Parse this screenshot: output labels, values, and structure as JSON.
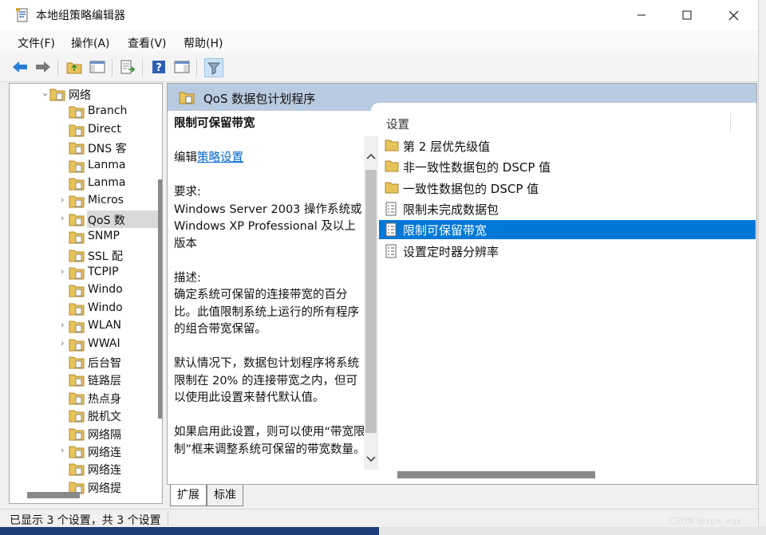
{
  "window": {
    "title": "本地组策略编辑器"
  },
  "menu": [
    "文件(F)",
    "操作(A)",
    "查看(V)",
    "帮助(H)"
  ],
  "tree": {
    "items": [
      {
        "label": "网络",
        "expanded": true
      },
      {
        "label": "Branch"
      },
      {
        "label": "Direct"
      },
      {
        "label": "DNS 客"
      },
      {
        "label": "Lanma"
      },
      {
        "label": "Lanma"
      },
      {
        "label": "Micros",
        "has_children": true
      },
      {
        "label": "QoS 数",
        "has_children": true,
        "selected": true
      },
      {
        "label": "SNMP"
      },
      {
        "label": "SSL 配"
      },
      {
        "label": "TCPIP",
        "has_children": true
      },
      {
        "label": "Windo"
      },
      {
        "label": "Windo"
      },
      {
        "label": "WLAN",
        "has_children": true
      },
      {
        "label": "WWAI",
        "has_children": true
      },
      {
        "label": "后台智"
      },
      {
        "label": "链路层"
      },
      {
        "label": "热点身"
      },
      {
        "label": "脱机文"
      },
      {
        "label": "网络隔"
      },
      {
        "label": "网络连",
        "has_children": true
      },
      {
        "label": "网络连"
      },
      {
        "label": "网络提"
      }
    ]
  },
  "pane_header": "QoS 数据包计划程序",
  "description": {
    "title": "限制可保留带宽",
    "edit_prefix": "编辑",
    "edit_link": "策略设置",
    "req_label": "要求:",
    "req_text": "Windows Server 2003 操作系统或 Windows XP Professional 及以上版本",
    "desc_label": "描述:",
    "desc_text": "确定系统可保留的连接带宽的百分比。此值限制系统上运行的所有程序的组合带宽保留。",
    "default_text": "默认情况下，数据包计划程序将系统限制在 20% 的连接带宽之内，但可以使用此设置来替代默认值。",
    "enable_text": "如果启用此设置，则可以使用“带宽限制”框来调整系统可保留的带宽数量。"
  },
  "settings": {
    "column_header": "设置",
    "items": [
      {
        "label": "第 2 层优先级值",
        "icon": "folder-icon"
      },
      {
        "label": "非一致性数据包的 DSCP 值",
        "icon": "folder-icon"
      },
      {
        "label": "一致性数据包的 DSCP 值",
        "icon": "folder-icon"
      },
      {
        "label": "限制未完成数据包",
        "icon": "policy-icon"
      },
      {
        "label": "限制可保留带宽",
        "icon": "policy-icon",
        "selected": true
      },
      {
        "label": "设置定时器分辨率",
        "icon": "policy-icon"
      }
    ]
  },
  "tabs": [
    "扩展",
    "标准"
  ],
  "status": "已显示 3 个设置，共 3 个设置",
  "watermark": "CSDN @xpx_xqx",
  "colors": {
    "selection": "#0078d7",
    "header": "#b9cbe0",
    "folder": "#e8c35a"
  }
}
